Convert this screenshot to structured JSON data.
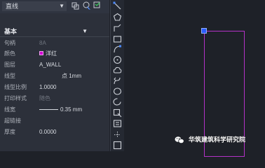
{
  "topbar": {
    "object_type": "直线",
    "icons": [
      "layer-copy-icon",
      "select-objects-icon",
      "quick-select-icon"
    ]
  },
  "section": {
    "title": "基本"
  },
  "properties": [
    {
      "label": "句柄",
      "value": "8A",
      "dim": true
    },
    {
      "label": "颜色",
      "value": "洋红",
      "swatch": "#d400d4"
    },
    {
      "label": "图层",
      "value": "A_WALL"
    },
    {
      "label": "线型",
      "value": "点 1mm",
      "indent": true
    },
    {
      "label": "线型比例",
      "value": "1.0000"
    },
    {
      "label": "打印样式",
      "value": "随色",
      "dim": true
    },
    {
      "label": "线宽",
      "value": "0.35 mm",
      "line": true
    },
    {
      "label": "超链接",
      "value": ""
    },
    {
      "label": "厚度",
      "value": "0.0000"
    }
  ],
  "toolstrip": [
    "line-icon",
    "polygon-icon",
    "rectangle-icon",
    "arc-icon",
    "circle-icon",
    "cloud-icon",
    "spline-icon",
    "ellipse-icon",
    "ellipse-arc-icon",
    "insert-block-icon",
    "make-block-icon",
    "point-icon",
    "hatch-icon"
  ],
  "canvas": {
    "outline_color": "#b432c8",
    "grip_color": "#2b5bff"
  },
  "watermark": {
    "text": "华筑建筑科学研究院",
    "icon": "wechat-icon"
  }
}
